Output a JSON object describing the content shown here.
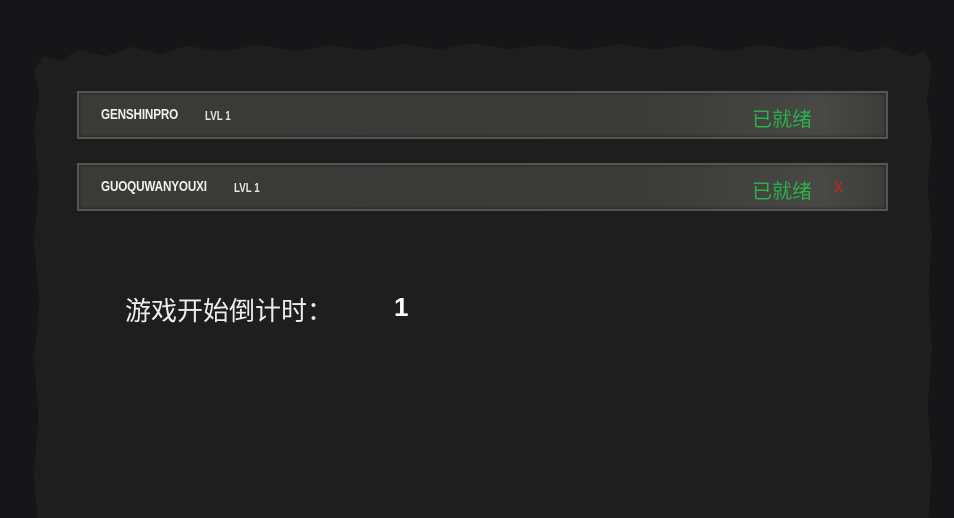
{
  "players": [
    {
      "name": "GENSHINPRO",
      "level": "LVL 1",
      "status": "已就绪",
      "kick_icon": ""
    },
    {
      "name": "GUOQUWANYOUXI",
      "level": "LVL 1",
      "status": "已就绪",
      "kick_icon": "x"
    }
  ],
  "countdown": {
    "label": "游戏开始倒计时：",
    "value": "1"
  },
  "colors": {
    "ready": "#2bb04a",
    "kick": "#c8241e",
    "background": "#161618",
    "panel": "#1e1e1f",
    "row": "#3a3a37"
  },
  "icons": {
    "kick": "close-icon"
  }
}
